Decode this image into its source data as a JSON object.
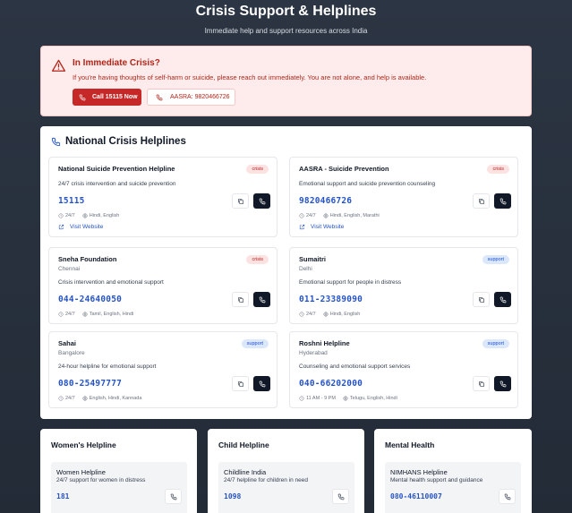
{
  "header": {
    "title": "Crisis Support & Helplines",
    "subtitle": "Immediate help and support resources across India"
  },
  "alert": {
    "title": "In Immediate Crisis?",
    "message": "If you're having thoughts of self-harm or suicide, please reach out immediately. You are not alone, and help is available.",
    "call_button": "Call 15115 Now",
    "aasra_button": "AASRA: 9820466726"
  },
  "national": {
    "title": "National Crisis Helplines",
    "visit_label": "Visit Website",
    "cards": [
      {
        "name": "National Suicide Prevention Helpline",
        "city": "",
        "badge": "crisis",
        "description": "24/7 crisis intervention and suicide prevention",
        "number": "15115",
        "hours": "24/7",
        "languages": "Hindi, English"
      },
      {
        "name": "AASRA - Suicide Prevention",
        "city": "",
        "badge": "crisis",
        "description": "Emotional support and suicide prevention counseling",
        "number": "9820466726",
        "hours": "24/7",
        "languages": "Hindi, English, Marathi"
      },
      {
        "name": "Sneha Foundation",
        "city": "Chennai",
        "badge": "crisis",
        "description": "Crisis intervention and emotional support",
        "number": "044-24640050",
        "hours": "24/7",
        "languages": "Tamil, English, Hindi"
      },
      {
        "name": "Sumaitri",
        "city": "Delhi",
        "badge": "support",
        "description": "Emotional support for people in distress",
        "number": "011-23389090",
        "hours": "24/7",
        "languages": "Hindi, English"
      },
      {
        "name": "Sahai",
        "city": "Bangalore",
        "badge": "support",
        "description": "24-hour helpline for emotional support",
        "number": "080-25497777",
        "hours": "24/7",
        "languages": "English, Hindi, Kannada"
      },
      {
        "name": "Roshni Helpline",
        "city": "Hyderabad",
        "badge": "support",
        "description": "Counseling and emotional support services",
        "number": "040-66202000",
        "hours": "11 AM - 9 PM",
        "languages": "Telugu, English, Hindi"
      }
    ]
  },
  "categories": [
    {
      "title": "Women's Helpline",
      "item_name": "Women Helpline",
      "item_desc": "24/7 support for women in distress",
      "item_number": "181"
    },
    {
      "title": "Child Helpline",
      "item_name": "Childline India",
      "item_desc": "24/7 helpline for children in need",
      "item_number": "1098"
    },
    {
      "title": "Mental Health",
      "item_name": "NIMHANS Helpline",
      "item_desc": "Mental health support and guidance",
      "item_number": "080-46110007"
    }
  ],
  "colors": {
    "alert_red": "#c62828",
    "link_blue": "#2553c7",
    "background": "#2c3543"
  },
  "icons": [
    "alert-triangle-icon",
    "phone-icon",
    "copy-icon",
    "clock-icon",
    "globe-icon",
    "external-link-icon"
  ]
}
